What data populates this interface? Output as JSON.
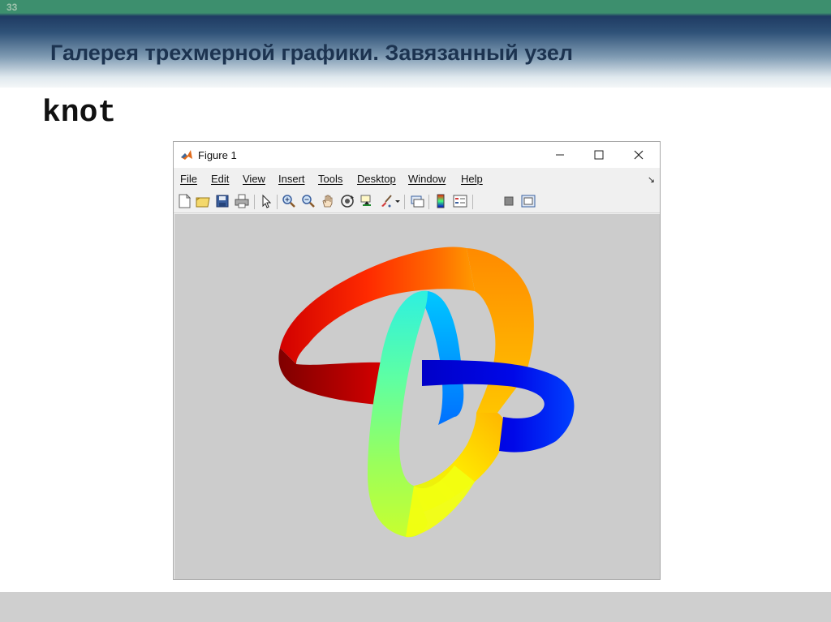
{
  "slide": {
    "number": "33",
    "title": "Галерея трехмерной графики. Завязанный узел",
    "command": "knot"
  },
  "window": {
    "title": "Figure 1",
    "controls": [
      "minimize-icon",
      "maximize-icon",
      "close-icon"
    ]
  },
  "menu": {
    "items": [
      "File",
      "Edit",
      "View",
      "Insert",
      "Tools",
      "Desktop",
      "Window",
      "Help"
    ]
  },
  "toolbar": {
    "icons": [
      "new-figure-icon",
      "open-file-icon",
      "save-icon",
      "print-icon",
      "edit-plot-arrow-icon",
      "zoom-in-icon",
      "zoom-out-icon",
      "pan-hand-icon",
      "rotate-3d-icon",
      "data-cursor-icon",
      "brush-icon",
      "link-plot-icon",
      "insert-colorbar-icon",
      "insert-legend-icon",
      "hide-plot-tools-icon",
      "show-plot-tools-icon"
    ]
  },
  "colors": {
    "figure_background": "#cccccc",
    "colormap": "jet"
  }
}
